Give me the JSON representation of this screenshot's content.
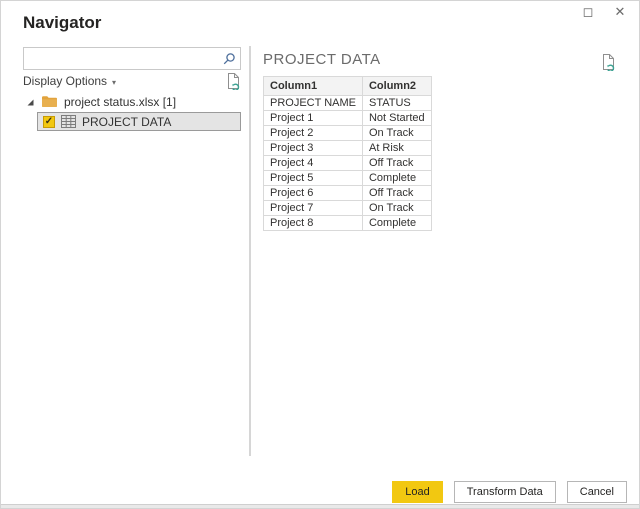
{
  "window": {
    "title": "Navigator",
    "maximize_glyph": "◻",
    "close_glyph": "✕"
  },
  "left_pane": {
    "search": {
      "value": "",
      "placeholder": ""
    },
    "display_options_label": "Display Options",
    "display_options_caret": "▾",
    "tree": {
      "root_item": {
        "label": "project status.xlsx [1]",
        "expanded": true
      },
      "child_item": {
        "label": "PROJECT DATA",
        "checked": true,
        "check_glyph": "✓",
        "selected": true
      }
    }
  },
  "right_pane": {
    "title": "PROJECT DATA",
    "table": {
      "headers": [
        "Column1",
        "Column2"
      ],
      "rows": [
        [
          "PROJECT NAME",
          "STATUS"
        ],
        [
          "Project 1",
          "Not Started"
        ],
        [
          "Project 2",
          "On Track"
        ],
        [
          "Project 3",
          "At Risk"
        ],
        [
          "Project 4",
          "Off Track"
        ],
        [
          "Project 5",
          "Complete"
        ],
        [
          "Project 6",
          "Off Track"
        ],
        [
          "Project 7",
          "On Track"
        ],
        [
          "Project 8",
          "Complete"
        ]
      ]
    }
  },
  "footer": {
    "load_label": "Load",
    "transform_label": "Transform Data",
    "cancel_label": "Cancel"
  },
  "colors": {
    "accent": "#F2C811",
    "selected_row_bg": "#E4E4E4",
    "selected_row_border": "#9A9A9A",
    "divider": "#D6D6D6",
    "table_border": "#D9D9D9",
    "table_header_bg": "#F3F3F3",
    "heading_gray": "#6B6B6B",
    "refresh_teal": "#3BA192",
    "search_icon_blue": "#4E6F9C",
    "folder_amber": "#E2A33D"
  },
  "icons": {
    "search": "magnifier",
    "tree_expand": "expanded-triangle",
    "folder": "folder",
    "table": "grid",
    "refresh_file": "file-with-refresh",
    "checkbox": "checked-amber"
  }
}
